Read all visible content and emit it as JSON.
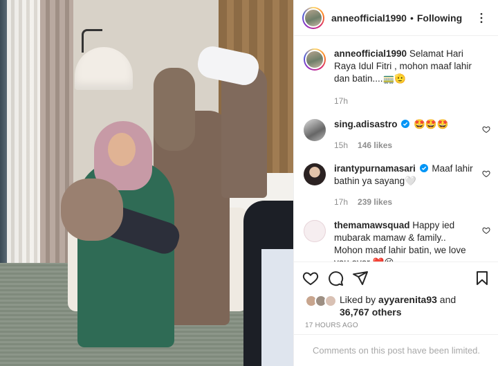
{
  "post": {
    "author": "anneofficial1990",
    "follow_status": "Following",
    "separator": "•",
    "caption_user": "anneofficial1990",
    "caption_text": "Selamat Hari Raya Idul Fitri , mohon maaf lahir dan batin....🚃🫡",
    "caption_time": "17h"
  },
  "comments": [
    {
      "user": "sing.adisastro",
      "verified": true,
      "text": "🤩🤩🤩",
      "time": "15h",
      "likes": "146 likes"
    },
    {
      "user": "irantypurnamasari",
      "verified": true,
      "text": "Maaf lahir bathin ya sayang🤍",
      "time": "17h",
      "likes": "239 likes"
    },
    {
      "user": "themamawsquad",
      "verified": false,
      "text": "Happy ied mubarak mamaw & family.. Mohon maaf lahir batin, we love you ever ❤️😘",
      "time": "",
      "likes": ""
    }
  ],
  "likes": {
    "prefix": "Liked by",
    "user": "ayyarenita93",
    "connector": "and",
    "others": "36,767 others"
  },
  "posted_ago": "17 HOURS AGO",
  "comments_limited": "Comments on this post have been limited.",
  "icons": {
    "more": "more-horizontal-icon",
    "like": "heart-icon",
    "comment": "comment-icon",
    "share": "paper-plane-icon",
    "save": "bookmark-icon",
    "verified": "verified-badge-icon"
  },
  "colors": {
    "verified_blue": "#0095f6",
    "text": "#262626",
    "muted": "#8e8e8e"
  }
}
